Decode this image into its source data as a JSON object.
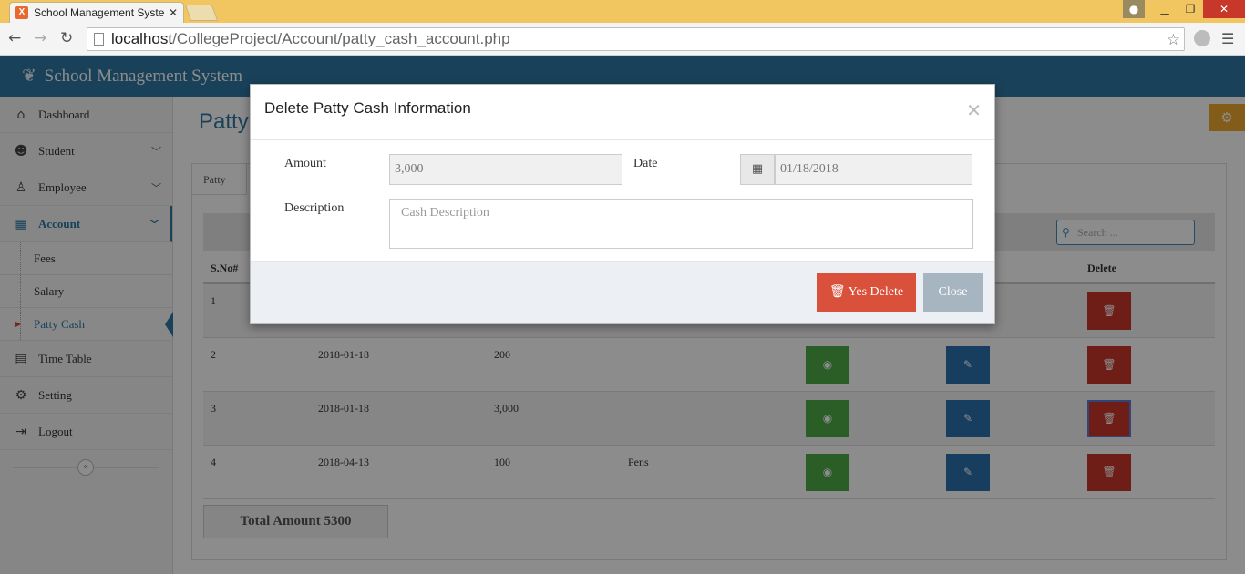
{
  "browser": {
    "tab_title": "School Management Syste",
    "favicon_letter": "X",
    "url_host": "localhost",
    "url_path": "/CollegeProject/Account/patty_cash_account.php"
  },
  "app": {
    "title": "School Management System"
  },
  "sidebar": {
    "items": [
      {
        "label": "Dashboard",
        "icon": "home-icon"
      },
      {
        "label": "Student",
        "icon": "users-icon"
      },
      {
        "label": "Employee",
        "icon": "person-icon"
      },
      {
        "label": "Account",
        "icon": "calculator-icon"
      }
    ],
    "sub_items": [
      {
        "label": "Fees"
      },
      {
        "label": "Salary"
      },
      {
        "label": "Patty Cash"
      }
    ],
    "bottom_items": [
      {
        "label": "Time Table",
        "icon": "calendar-icon"
      },
      {
        "label": "Setting",
        "icon": "gear-icon"
      },
      {
        "label": "Logout",
        "icon": "logout-icon"
      }
    ]
  },
  "main": {
    "page_title": "Patty",
    "panel_tab": "Patty Cas",
    "search_placeholder": "Search ...",
    "columns": {
      "sno": "S.No#",
      "delete": "Delete"
    },
    "rows": [
      {
        "sno": "1",
        "date": "",
        "amount": "",
        "description": ""
      },
      {
        "sno": "2",
        "date": "2018-01-18",
        "amount": "200",
        "description": ""
      },
      {
        "sno": "3",
        "date": "2018-01-18",
        "amount": "3,000",
        "description": ""
      },
      {
        "sno": "4",
        "date": "2018-04-13",
        "amount": "100",
        "description": "Pens"
      }
    ],
    "total": "Total Amount 5300"
  },
  "modal": {
    "title": "Delete Patty Cash Information",
    "amount_label": "Amount",
    "amount_value": "3,000",
    "date_label": "Date",
    "date_value": "01/18/2018",
    "description_label": "Description",
    "description_placeholder": "Cash Description",
    "delete_button": "Yes Delete",
    "close_button": "Close"
  },
  "colors": {
    "header": "#2f78a4",
    "danger": "#d9513b",
    "view": "#4fa948",
    "edit": "#2b6fae",
    "warning": "#f0a830"
  }
}
